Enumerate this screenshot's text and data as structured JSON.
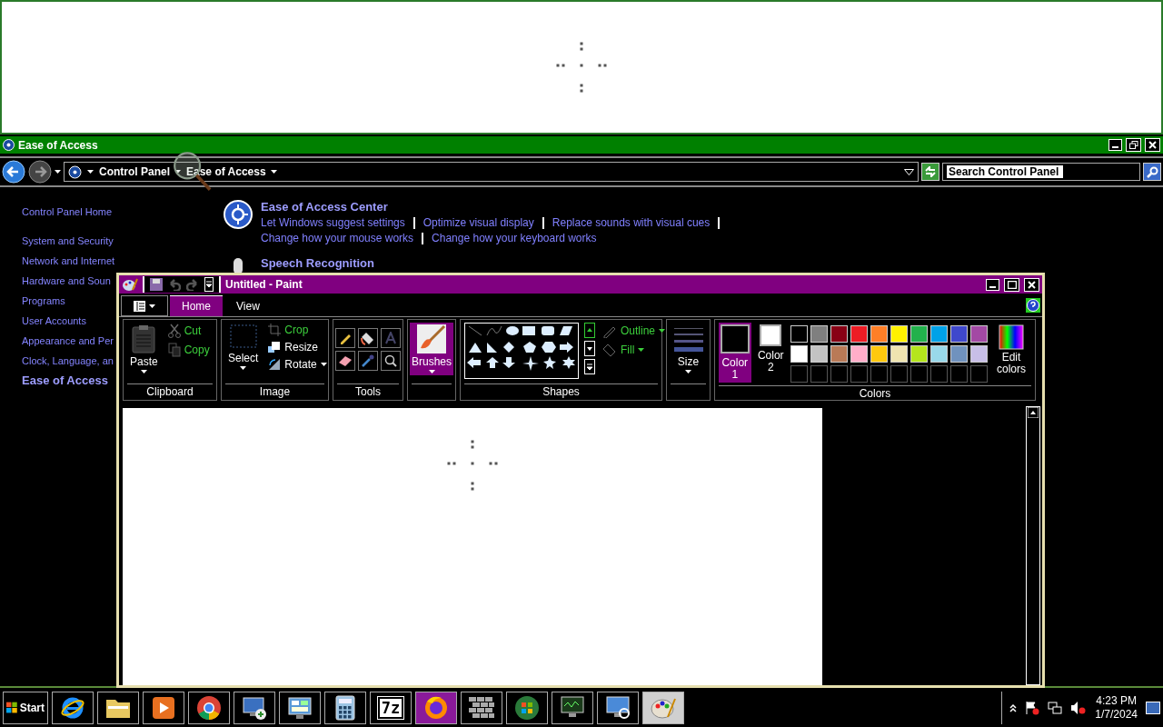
{
  "control_panel": {
    "title": "Ease of Access",
    "breadcrumb": [
      "Control Panel",
      "Ease of Access"
    ],
    "search": {
      "placeholder": "Search Control Panel"
    },
    "nav": [
      {
        "label": "Control Panel Home",
        "selected": false
      },
      {
        "label": "System and Security",
        "selected": false
      },
      {
        "label": "Network and Internet",
        "selected": false
      },
      {
        "label": "Hardware and Soun",
        "selected": false
      },
      {
        "label": "Programs",
        "selected": false
      },
      {
        "label": "User Accounts",
        "selected": false
      },
      {
        "label": "Appearance and Per",
        "selected": false
      },
      {
        "label": "Clock, Language, an",
        "selected": false
      },
      {
        "label": "Ease of Access",
        "selected": true
      }
    ],
    "sections": [
      {
        "kind": "center",
        "title": "Ease of Access Center",
        "link_rows": [
          [
            "Let Windows suggest settings",
            "Optimize visual display",
            "Replace sounds with visual cues"
          ],
          [
            "Change how your mouse works",
            "Change how your keyboard works"
          ]
        ]
      },
      {
        "kind": "speech",
        "title": "Speech Recognition"
      }
    ]
  },
  "paint": {
    "title": "Untitled - Paint",
    "tabs": [
      {
        "label": "Home",
        "selected": true
      },
      {
        "label": "View",
        "selected": false
      }
    ],
    "clipboard": {
      "label": "Clipboard",
      "paste": {
        "label": "Paste",
        "disabled": false
      },
      "cut": {
        "label": "Cut",
        "disabled": true
      },
      "copy": {
        "label": "Copy",
        "disabled": true
      }
    },
    "image": {
      "label": "Image",
      "select": {
        "label": "Select",
        "disabled": false
      },
      "crop": {
        "label": "Crop",
        "disabled": true
      },
      "resize": {
        "label": "Resize",
        "disabled": false
      },
      "rotate": {
        "label": "Rotate",
        "disabled": false
      }
    },
    "tools": {
      "label": "Tools"
    },
    "brushes": {
      "label": "Brushes",
      "selected": true
    },
    "shapes": {
      "label": "Shapes",
      "outline": {
        "label": "Outline",
        "disabled": true
      },
      "fill": {
        "label": "Fill",
        "disabled": true
      }
    },
    "size": {
      "label": "Size"
    },
    "colors": {
      "label": "Colors",
      "slots": [
        {
          "label": "Color 1",
          "color": "#000000",
          "selected": true
        },
        {
          "label": "Color 2",
          "color": "#ffffff",
          "selected": false
        }
      ],
      "palette": [
        {
          "color": "#000000"
        },
        {
          "color": "#7f7f7f"
        },
        {
          "color": "#880015"
        },
        {
          "color": "#ed1c24"
        },
        {
          "color": "#ff7f27"
        },
        {
          "color": "#fff200"
        },
        {
          "color": "#22b14c"
        },
        {
          "color": "#00a2e8"
        },
        {
          "color": "#3f48cc"
        },
        {
          "color": "#a349a4"
        },
        {
          "color": "#ffffff"
        },
        {
          "color": "#c3c3c3"
        },
        {
          "color": "#b97a57"
        },
        {
          "color": "#ffaec9"
        },
        {
          "color": "#ffc90e"
        },
        {
          "color": "#efe4b0"
        },
        {
          "color": "#b5e61d"
        },
        {
          "color": "#99d9ea"
        },
        {
          "color": "#7092be"
        },
        {
          "color": "#c8bfe7"
        }
      ],
      "edit": "Edit colors"
    }
  },
  "taskbar": {
    "start": "Start",
    "apps": [
      {
        "kind": "ie",
        "selected": false,
        "highlighted": false
      },
      {
        "kind": "explorer",
        "selected": false,
        "highlighted": false
      },
      {
        "kind": "media",
        "selected": false,
        "highlighted": false
      },
      {
        "kind": "chrome",
        "selected": false,
        "highlighted": false
      },
      {
        "kind": "remote",
        "selected": false,
        "highlighted": false
      },
      {
        "kind": "panel",
        "selected": false,
        "highlighted": false
      },
      {
        "kind": "calculator",
        "selected": false,
        "highlighted": false
      },
      {
        "kind": "archive",
        "label": "7z",
        "selected": false,
        "highlighted": false
      },
      {
        "kind": "firefox",
        "selected": false,
        "highlighted": true
      },
      {
        "kind": "firewall",
        "selected": false,
        "highlighted": false
      },
      {
        "kind": "windows",
        "selected": false,
        "highlighted": false
      },
      {
        "kind": "monitor",
        "selected": false,
        "highlighted": false
      },
      {
        "kind": "network",
        "selected": false,
        "highlighted": false
      },
      {
        "kind": "paint",
        "selected": true,
        "highlighted": false
      }
    ],
    "clock": {
      "time": "4:23 PM",
      "date": "1/7/2024"
    }
  }
}
